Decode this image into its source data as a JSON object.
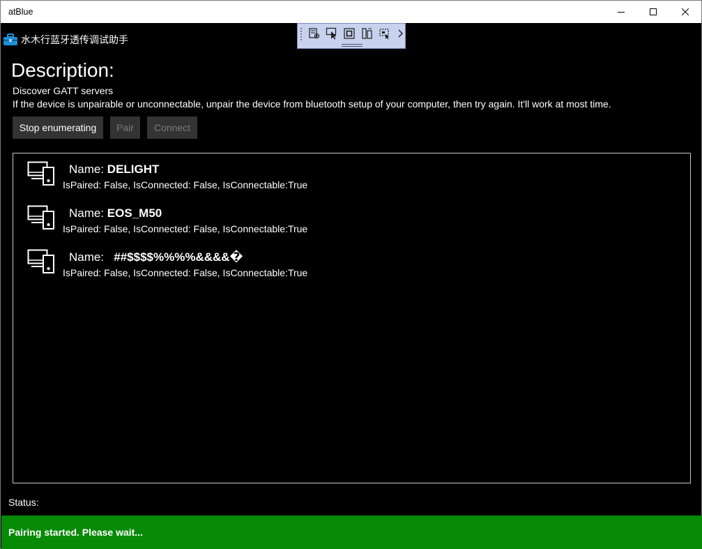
{
  "window": {
    "title": "atBlue",
    "controls": [
      "minimize-icon",
      "maximize-icon",
      "close-icon"
    ]
  },
  "app": {
    "name": "水木行蓝牙透传调试助手",
    "icon": "toolbox-icon",
    "accent": "#1e8fd6"
  },
  "debug_toolbar": {
    "icons": [
      "live-visual-tree-icon",
      "select-element-icon",
      "display-layout-adorners-icon",
      "track-focus-icon",
      "binding-failures-icon",
      "chevron-right-icon"
    ],
    "background": "#c8d2ee"
  },
  "description": {
    "heading": "Description:",
    "line1": "Discover GATT servers",
    "line2": "If the device is unpairable or unconnectable, unpair the device from bluetooth setup of your computer, then try again. It'll work at most time."
  },
  "buttons": {
    "stop": "Stop enumerating",
    "pair": "Pair",
    "connect": "Connect"
  },
  "devices": [
    {
      "name_label": "Name: ",
      "name": "DELIGHT",
      "info": "IsPaired: False, IsConnected: False, IsConnectable:True",
      "icon": "devices-icon"
    },
    {
      "name_label": "Name: ",
      "name": "EOS_M50",
      "info": "IsPaired: False, IsConnected: False, IsConnectable:True",
      "icon": "devices-icon"
    },
    {
      "name_label": "Name:   ",
      "name": "##$$$$%%%%&&&&�",
      "info": "IsPaired: False, IsConnected: False, IsConnectable:True",
      "icon": "devices-icon"
    }
  ],
  "status": {
    "label": "Status:",
    "message": "Pairing started. Please wait...",
    "color": "#078a07"
  }
}
